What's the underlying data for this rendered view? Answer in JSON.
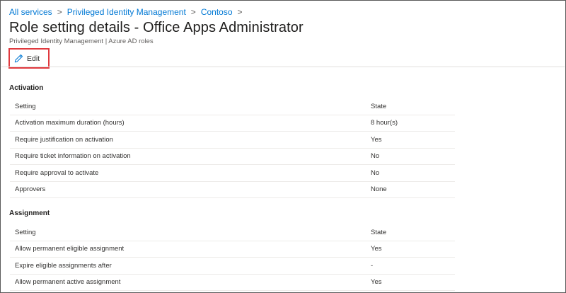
{
  "breadcrumb": {
    "items": [
      "All services",
      "Privileged Identity Management",
      "Contoso"
    ],
    "separator": ">"
  },
  "page": {
    "title": "Role setting details - Office Apps Administrator",
    "subtitle": "Privileged Identity Management | Azure AD roles"
  },
  "toolbar": {
    "edit_label": "Edit",
    "edit_icon": "pencil-icon",
    "highlight_color": "#e0393e"
  },
  "activation": {
    "title": "Activation",
    "headers": {
      "setting": "Setting",
      "state": "State"
    },
    "rows": [
      {
        "setting": "Activation maximum duration (hours)",
        "state": "8 hour(s)"
      },
      {
        "setting": "Require justification on activation",
        "state": "Yes"
      },
      {
        "setting": "Require ticket information on activation",
        "state": "No"
      },
      {
        "setting": "Require approval to activate",
        "state": "No"
      },
      {
        "setting": "Approvers",
        "state": "None"
      }
    ]
  },
  "assignment": {
    "title": "Assignment",
    "headers": {
      "setting": "Setting",
      "state": "State"
    },
    "rows": [
      {
        "setting": "Allow permanent eligible assignment",
        "state": "Yes"
      },
      {
        "setting": "Expire eligible assignments after",
        "state": "-"
      },
      {
        "setting": "Allow permanent active assignment",
        "state": "Yes"
      }
    ]
  },
  "colors": {
    "link": "#0078d4",
    "text": "#323130",
    "divider": "#edebe9"
  }
}
